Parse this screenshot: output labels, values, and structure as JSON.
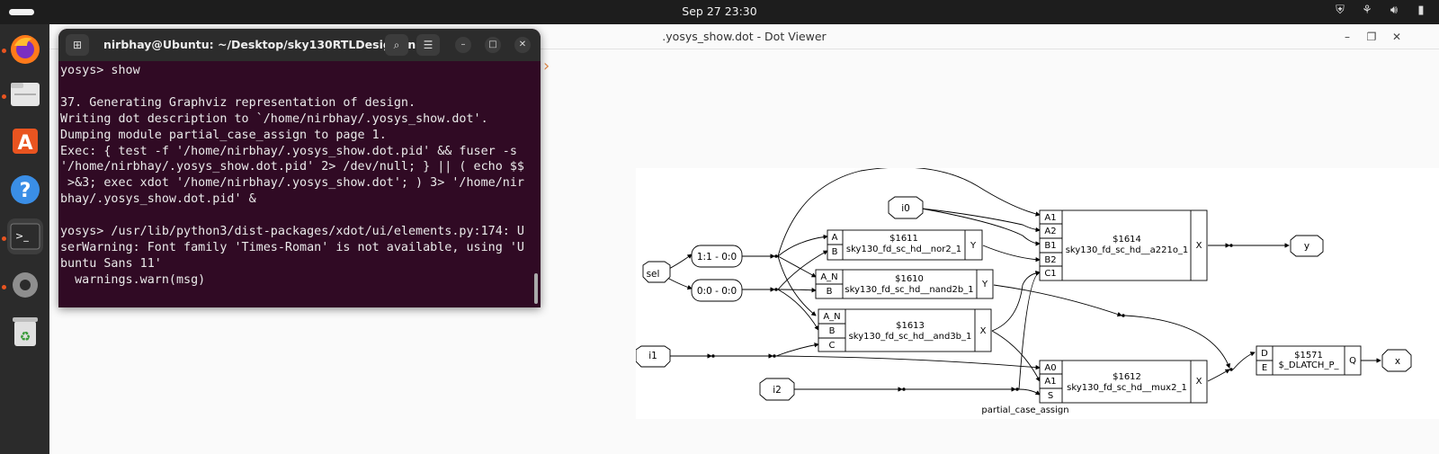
{
  "topbar": {
    "clock": "Sep 27  23:30"
  },
  "dock": {
    "items": [
      "firefox-icon",
      "files-icon",
      "app-center-icon",
      "help-icon",
      "terminal-icon",
      "settings-icon",
      "trash-icon"
    ]
  },
  "viewer": {
    "title": ".yosys_show.dot - Dot Viewer"
  },
  "terminal": {
    "title": "nirbhay@Ubuntu: ~/Desktop/sky130RTLDesignAn...",
    "lines": [
      "yosys> show",
      "",
      "37. Generating Graphviz representation of design.",
      "Writing dot description to `/home/nirbhay/.yosys_show.dot'.",
      "Dumping module partial_case_assign to page 1.",
      "Exec: { test -f '/home/nirbhay/.yosys_show.dot.pid' && fuser -s",
      "'/home/nirbhay/.yosys_show.dot.pid' 2> /dev/null; } || ( echo $$",
      " >&3; exec xdot '/home/nirbhay/.yosys_show.dot'; ) 3> '/home/nir",
      "bhay/.yosys_show.dot.pid' &",
      "",
      "yosys> /usr/lib/python3/dist-packages/xdot/ui/elements.py:174: U",
      "serWarning: Font family 'Times-Roman' is not available, using 'U",
      "buntu Sans 11'",
      "  warnings.warn(msg)"
    ]
  },
  "graph": {
    "module_label": "partial_case_assign",
    "ports": {
      "sel": "sel",
      "i0": "i0",
      "i1": "i1",
      "i2": "i2",
      "y": "y",
      "x": "x"
    },
    "slices": {
      "s1": "1:1 - 0:0",
      "s0": "0:0 - 0:0"
    },
    "cells": {
      "c1611": {
        "id": "$1611",
        "type": "sky130_fd_sc_hd__nor2_1",
        "inputs": [
          "A",
          "B"
        ],
        "output": "Y"
      },
      "c1610": {
        "id": "$1610",
        "type": "sky130_fd_sc_hd__nand2b_1",
        "inputs": [
          "A_N",
          "B"
        ],
        "output": "Y"
      },
      "c1613": {
        "id": "$1613",
        "type": "sky130_fd_sc_hd__and3b_1",
        "inputs": [
          "A_N",
          "B",
          "C"
        ],
        "output": "X"
      },
      "c1614": {
        "id": "$1614",
        "type": "sky130_fd_sc_hd__a221o_1",
        "inputs": [
          "A1",
          "A2",
          "B1",
          "B2",
          "C1"
        ],
        "output": "X"
      },
      "c1612": {
        "id": "$1612",
        "type": "sky130_fd_sc_hd__mux2_1",
        "inputs": [
          "A0",
          "A1",
          "S"
        ],
        "output": "X"
      },
      "c1571": {
        "id": "$1571",
        "type": "$_DLATCH_P_",
        "inputs": [
          "D",
          "E"
        ],
        "output": "Q"
      }
    }
  }
}
